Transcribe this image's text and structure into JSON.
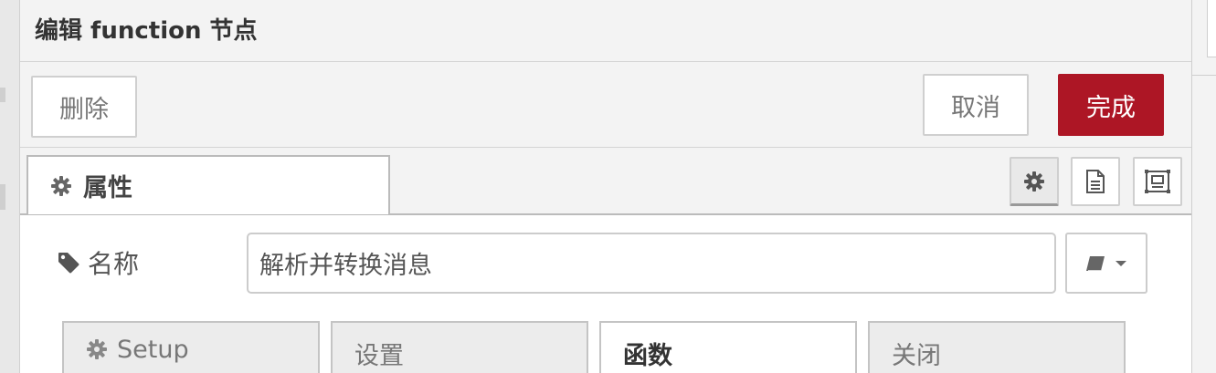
{
  "tray": {
    "title": "编辑 function 节点",
    "delete_label": "删除",
    "cancel_label": "取消",
    "done_label": "完成"
  },
  "tabs": {
    "properties_label": "属性",
    "icons": [
      "gear-icon",
      "description-icon",
      "appearance-icon"
    ]
  },
  "form": {
    "name_label": "名称",
    "name_value": "解析并转换消息"
  },
  "subtabs": [
    {
      "label": "Setup",
      "icon": "gear-icon"
    },
    {
      "label": "设置"
    },
    {
      "label": "函数",
      "active": true
    },
    {
      "label": "关闭"
    }
  ],
  "colors": {
    "primary": "#ad1625",
    "tray_bg": "#f3f3f3",
    "border": "#cfcfcf"
  }
}
